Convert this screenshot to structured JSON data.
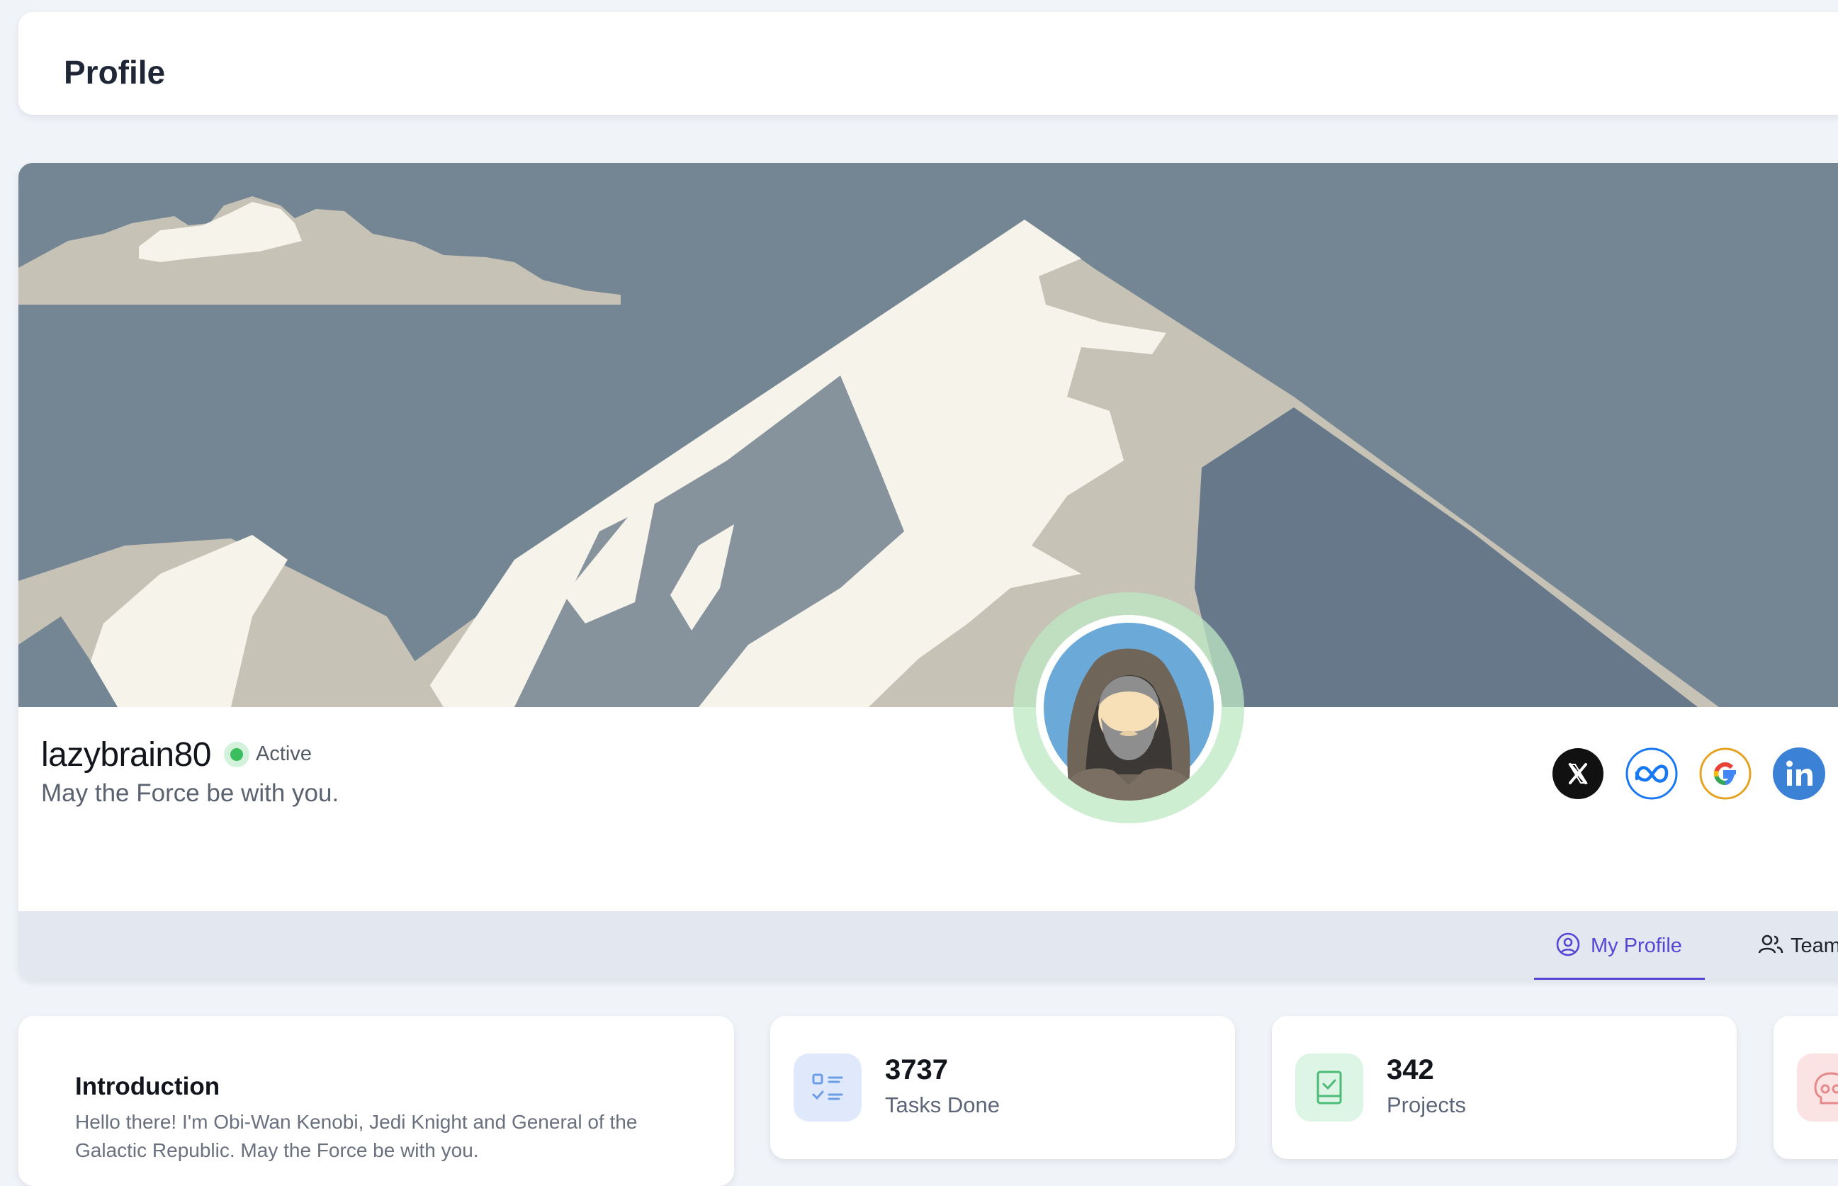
{
  "page": {
    "title": "Profile"
  },
  "profile": {
    "username": "lazybrain80",
    "status": "Active",
    "bio": "May the Force be with you."
  },
  "social": [
    {
      "name": "X",
      "icon": "x-icon",
      "color": "#111111"
    },
    {
      "name": "Meta",
      "icon": "meta-icon",
      "color": "#1877f2"
    },
    {
      "name": "Google",
      "icon": "google-icon",
      "color": "#e6a321"
    },
    {
      "name": "LinkedIn",
      "icon": "linkedin-icon",
      "color": "#3b82d6"
    }
  ],
  "tabs": [
    {
      "label": "My Profile",
      "icon": "user-circle-icon",
      "active": true
    },
    {
      "label": "Teams",
      "icon": "users-icon",
      "active": false
    }
  ],
  "introduction": {
    "title": "Introduction",
    "text": "Hello there! I'm Obi-Wan Kenobi, Jedi Knight and General of the Galactic Republic. May the Force be with you."
  },
  "stats": [
    {
      "value": "3737",
      "label": "Tasks Done",
      "icon": "checklist-icon",
      "color": "#dfe9fb"
    },
    {
      "value": "342",
      "label": "Projects",
      "icon": "clipboard-check-icon",
      "color": "#dcf5e5"
    },
    {
      "icon": "skull-icon",
      "color": "#fbe3e3"
    }
  ],
  "colors": {
    "accent": "#5546d6",
    "active": "#3bbf5e"
  }
}
